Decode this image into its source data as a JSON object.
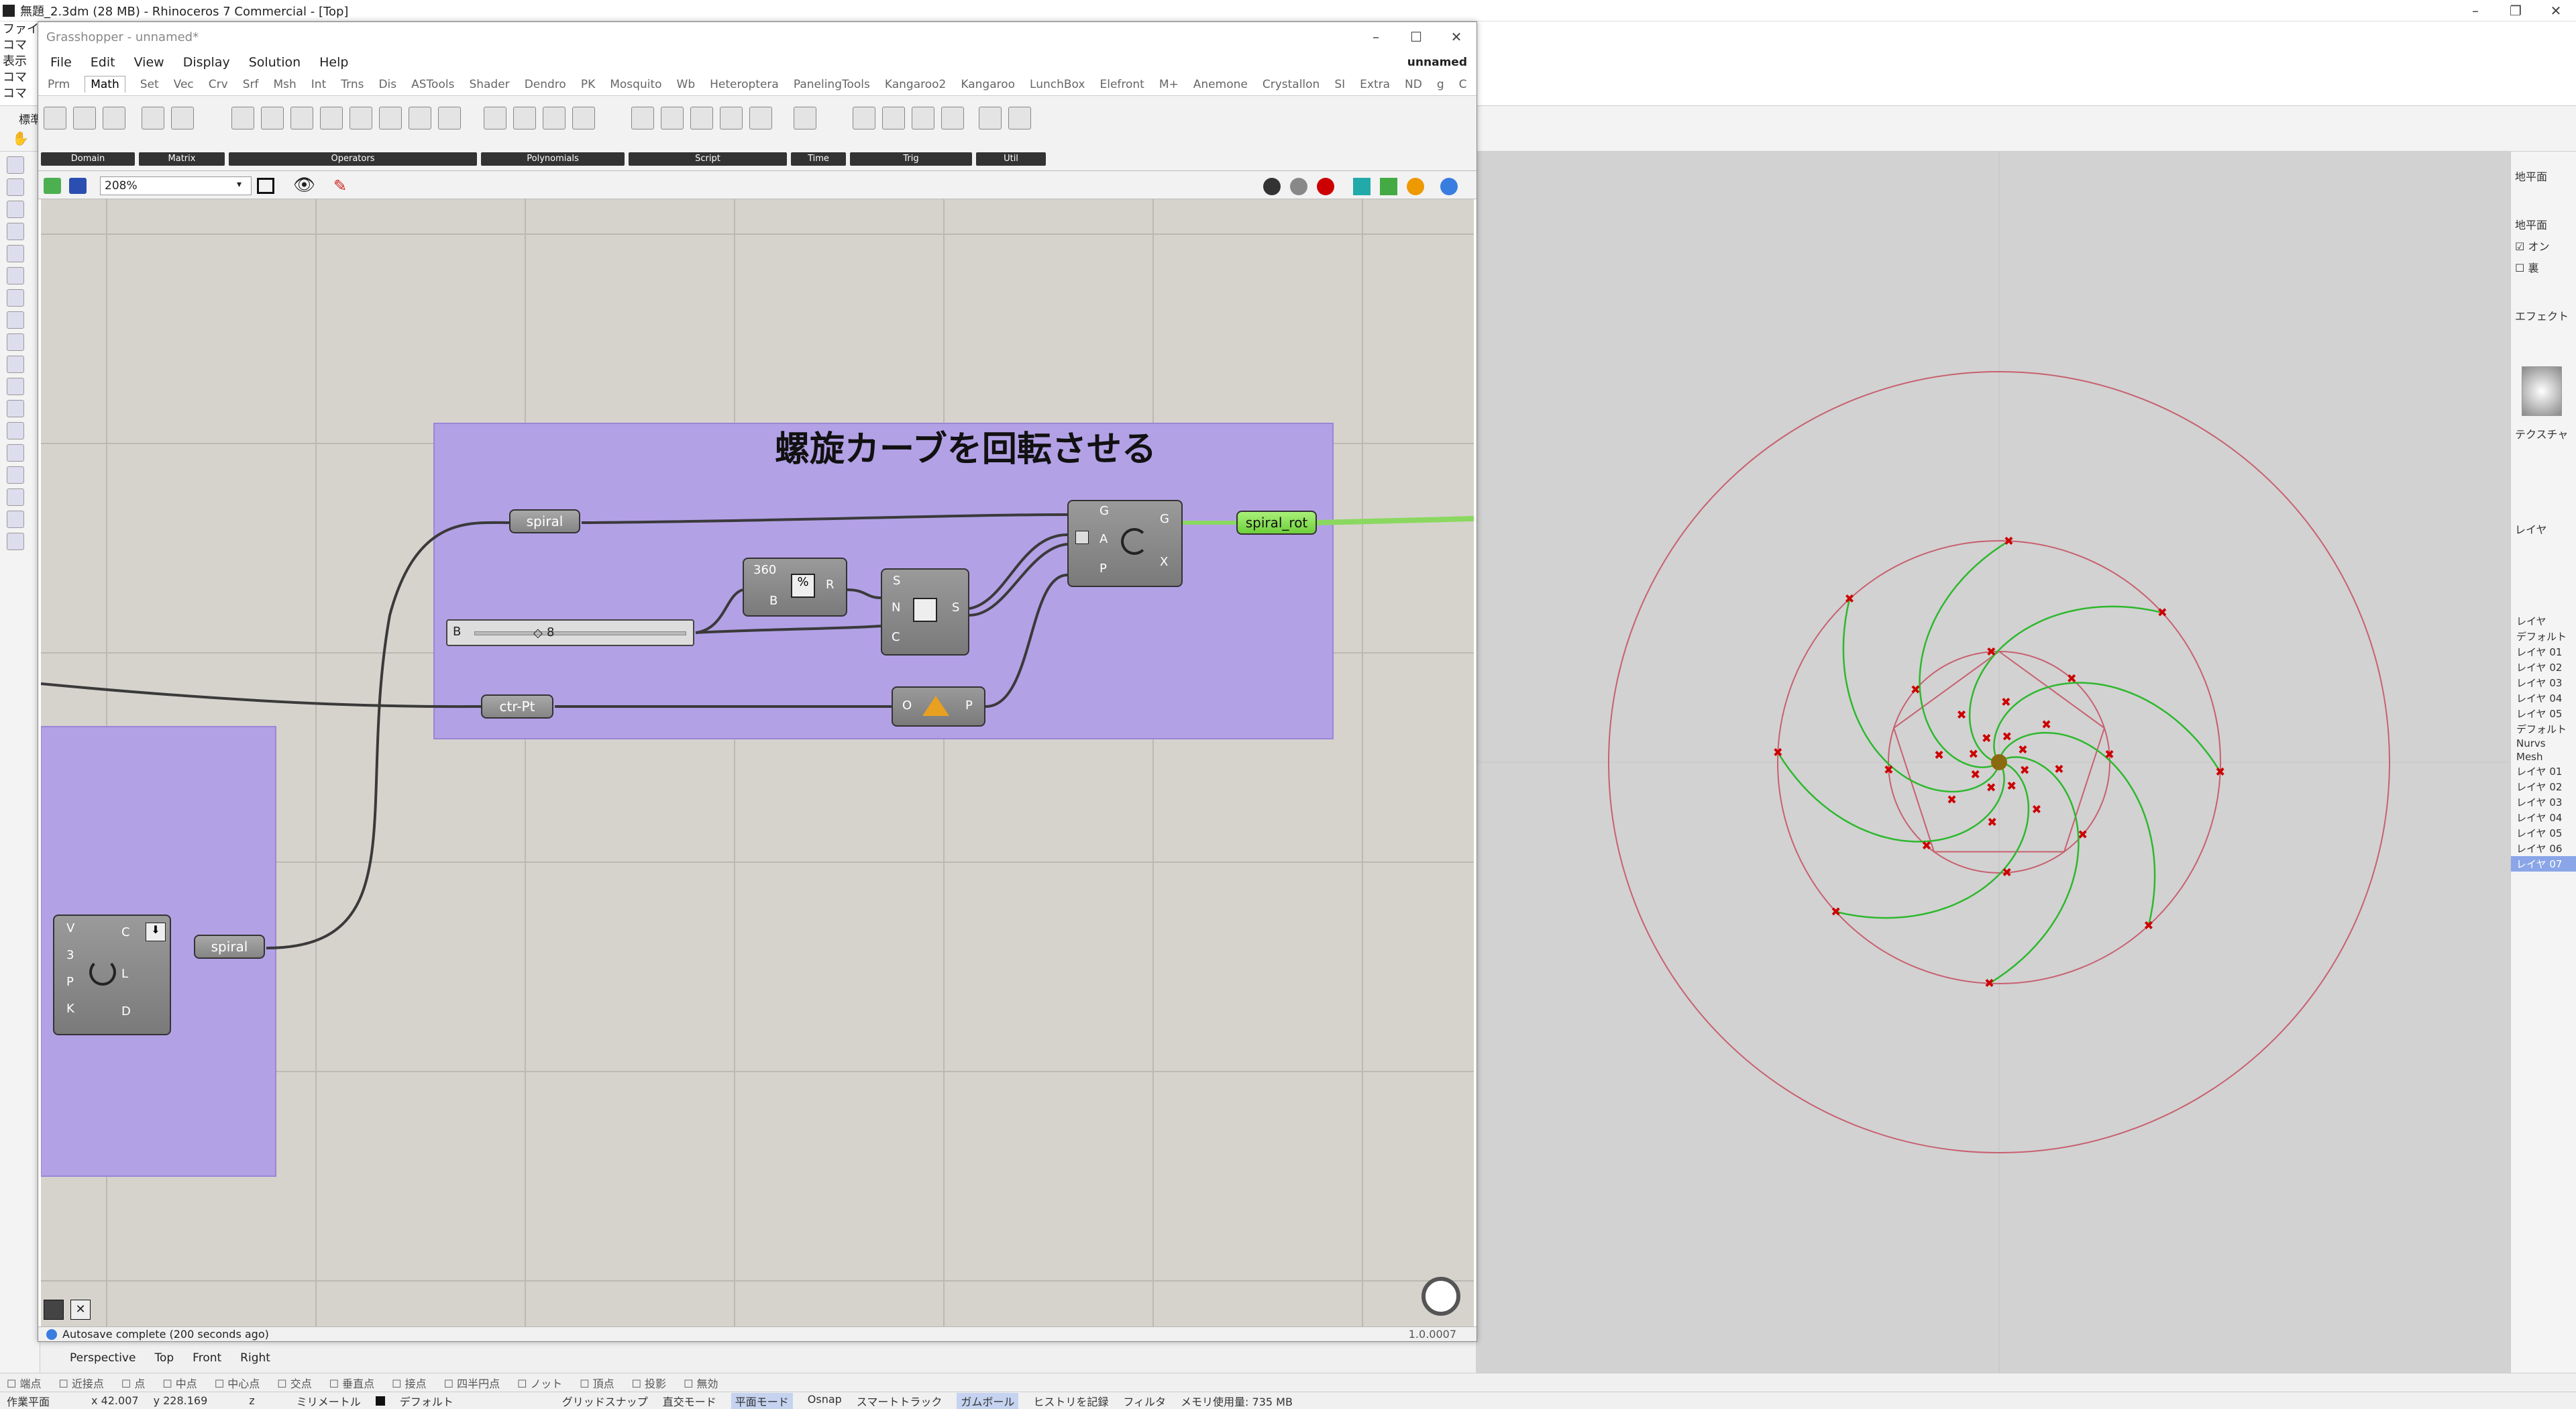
{
  "rhino": {
    "title": "無題_2.3dm (28 MB) - Rhinoceros 7 Commercial - [Top]",
    "cmd_lines": [
      "ファイル",
      "コマ",
      "表示",
      "コマ",
      "コマ"
    ],
    "toolbar_label": "標準"
  },
  "gh": {
    "title": "Grasshopper - unnamed*",
    "menu": [
      "File",
      "Edit",
      "View",
      "Display",
      "Solution",
      "Help"
    ],
    "doc_name": "unnamed",
    "tabs": [
      "Prm",
      "Math",
      "Set",
      "Vec",
      "Crv",
      "Srf",
      "Msh",
      "Int",
      "Trns",
      "Dis",
      "ASTools",
      "Shader",
      "Dendro",
      "PK",
      "Mosquito",
      "Wb",
      "Heteroptera",
      "PanelingTools",
      "Kangaroo2",
      "Kangaroo",
      "LunchBox",
      "Elefront",
      "M+",
      "Anemone",
      "Crystallon",
      "SI",
      "Extra",
      "ND",
      "g",
      "C"
    ],
    "active_tab": "Math",
    "ribbon_groups": [
      "Domain",
      "Matrix",
      "Operators",
      "Polynomials",
      "Script",
      "Time",
      "Trig",
      "Util"
    ],
    "zoom": "208%",
    "group_title": "螺旋カーブを回転させる",
    "params": {
      "spiral_top": "spiral",
      "spiral_bottom": "spiral",
      "spiral_rot": "spiral_rot",
      "ctr_pt": "ctr-Pt"
    },
    "division": {
      "a": "360",
      "b": "B",
      "out": "R"
    },
    "series": {
      "s": "S",
      "n": "N",
      "c": "C",
      "out": "S"
    },
    "rotate": {
      "g": "G",
      "a": "A",
      "p": "P",
      "out_g": "G",
      "out_x": "X"
    },
    "slider": {
      "label": "B",
      "value": "8"
    },
    "plane": {
      "o": "O",
      "p": "P"
    },
    "spiral_comp": {
      "v": "V",
      "three": "3",
      "p": "P",
      "k": "K",
      "c": "C",
      "l": "L",
      "d": "D"
    },
    "status": "Autosave complete (200 seconds ago)",
    "version": "1.0.0007"
  },
  "viewport_tabs": [
    "Perspective",
    "Top",
    "Front",
    "Right"
  ],
  "osnap": [
    "端点",
    "近接点",
    "点",
    "中点",
    "中心点",
    "交点",
    "垂直点",
    "接点",
    "四半円点",
    "ノット",
    "頂点",
    "投影",
    "無効"
  ],
  "status_bar": {
    "plane": "作業平面",
    "x": "x 42.007",
    "y": "y 228.169",
    "z": "z",
    "unit": "ミリメートル",
    "layer": "デフォルト",
    "items": [
      "グリッドスナップ",
      "直交モード",
      "平面モード",
      "Osnap",
      "スマートトラック",
      "ガムボール",
      "ヒストリを記録",
      "フィルタ"
    ],
    "memory": "メモリ使用量: 735 MB",
    "active_items": [
      "平面モード",
      "ガムボール"
    ]
  },
  "right_panel": {
    "ground": "地平面",
    "ground2": "地平面",
    "on": "オン",
    "back": "裏",
    "effect": "エフェクト",
    "texture": "テクスチャ",
    "layers_title": "レイヤ",
    "layers": [
      "レイヤ",
      "デフォルト",
      "レイヤ 01",
      "レイヤ 02",
      "レイヤ 03",
      "レイヤ 04",
      "レイヤ 05",
      "デフォルト",
      "Nurvs",
      "Mesh",
      "レイヤ 01",
      "レイヤ 02",
      "レイヤ 03",
      "レイヤ 04",
      "レイヤ 05",
      "レイヤ 06",
      "レイヤ 07"
    ],
    "selected_layer": "レイヤ 07"
  },
  "colors": {
    "group": "#b3a1e6",
    "canvas": "#d6d3cd",
    "spiral_green": "#2db82d",
    "circle_red": "#c86070",
    "point_red": "#cc0000",
    "wire": "#3a3a3a"
  }
}
